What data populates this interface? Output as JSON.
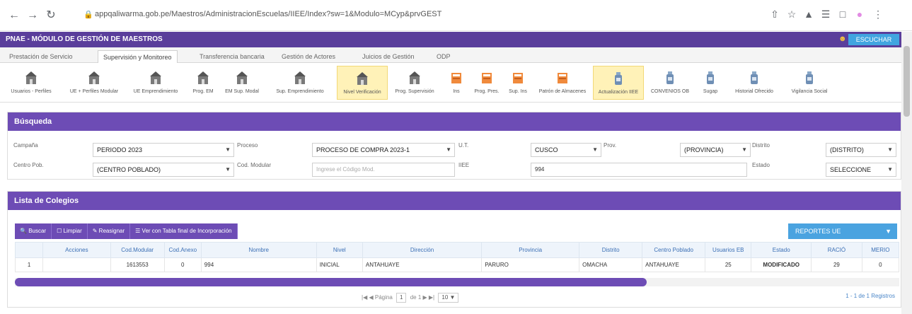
{
  "browser": {
    "back_icon": "arrow-left",
    "forward_icon": "arrow-right",
    "reload_icon": "reload",
    "url": "appqaliwarma.gob.pe/Maestros/AdministracionEscuelas/IIEE/Index?sw=1&Modulo=MCyp&prvGEST"
  },
  "app": {
    "title": "PNAE - MÓDULO DE GESTIÓN DE MAESTROS",
    "user_label": "ESCUCHAR",
    "header_color": "#5a3e9b",
    "accent_color": "#6d4cb5"
  },
  "module_tabs": [
    {
      "label": "Prestación de Servicio",
      "active": false
    },
    {
      "label": "Supervisión y Monitoreo",
      "active": true
    },
    {
      "label": "Transferencia bancaria",
      "active": false
    },
    {
      "label": "Gestión de Actores",
      "active": false
    },
    {
      "label": "Juicios de Gestión",
      "active": false
    },
    {
      "label": "ODP",
      "active": false
    }
  ],
  "ribbon": [
    {
      "label": "Usuarios - Perfiles",
      "icon": "building-icon"
    },
    {
      "label": "UE + Perfiles Modular",
      "icon": "building-icon"
    },
    {
      "label": "UE Emprendimiento",
      "icon": "building-icon"
    },
    {
      "label": "Prog. EM",
      "icon": "building-icon"
    },
    {
      "label": "EM Sup. Modal",
      "icon": "building-icon"
    },
    {
      "label": "Sup. Emprendimiento",
      "icon": "building-icon"
    },
    {
      "label": "Nivel Verificación",
      "icon": "building-icon",
      "highlight": true
    },
    {
      "label": "Prog. Supervisión",
      "icon": "building-icon"
    },
    {
      "label": "Ins",
      "icon": "book-icon"
    },
    {
      "label": "Prog. Pres.",
      "icon": "book-icon"
    },
    {
      "label": "Sup. Ins",
      "icon": "book-icon"
    },
    {
      "label": "Patrón de Almacenes",
      "icon": "book-icon"
    },
    {
      "label": "Actualización IIEE",
      "icon": "bottle-icon",
      "highlight": true
    },
    {
      "label": "CONVENIOS OB",
      "icon": "bottle-icon"
    },
    {
      "label": "Sugap",
      "icon": "bottle-icon"
    },
    {
      "label": "Historial Ofrecido",
      "icon": "bottle-icon"
    },
    {
      "label": "Vigilancia Social",
      "icon": "bottle-icon"
    }
  ],
  "search": {
    "title": "Búsqueda",
    "campana_label": "Campaña",
    "campana_value": "PERIODO 2023",
    "proceso_label": "Proceso",
    "proceso_value": "PROCESO DE COMPRA 2023-1",
    "ut_label": "U.T.",
    "ut_value": "CUSCO",
    "prov_label": "Prov.",
    "prov_value": "(PROVINCIA)",
    "distrito_label": "Distrito",
    "distrito_value": "(DISTRITO)",
    "centro_label": "Centro Pob.",
    "centro_value": "(CENTRO POBLADO)",
    "cod_modular_label": "Cod. Modular",
    "cod_modular_placeholder": "Ingrese el Código Mod.",
    "iiee_label": "IIEE",
    "iiee_value": "994",
    "estado_label": "Estado",
    "estado_value": "SELECCIONE"
  },
  "list": {
    "title": "Lista de Colegios",
    "buttons": [
      "Buscar",
      "Limpiar",
      "Reasignar",
      "Ver con Tabla final de Incorporación"
    ],
    "report_label": "REPORTES UE",
    "columns": [
      "",
      "Acciones",
      "Cod.Modular",
      "Cod.Anexo",
      "Nombre",
      "Nivel",
      "Dirección",
      "Provincia",
      "Distrito",
      "Centro Poblado",
      "Usuarios EB",
      "Estado",
      "RACIÓ",
      "MERIO"
    ],
    "rows": [
      [
        "1",
        "",
        "1613553",
        "0",
        "994",
        "INICIAL",
        "ANTAHUAYE",
        "PARURO",
        "OMACHA",
        "ANTAHUAYE",
        "25",
        "MODIFICADO",
        "29",
        "0"
      ]
    ],
    "pager_label": "Página",
    "pager_page": "1",
    "pager_of": "de 1",
    "pager_size": "10",
    "pager_info": "1 - 1 de 1 Registros"
  }
}
